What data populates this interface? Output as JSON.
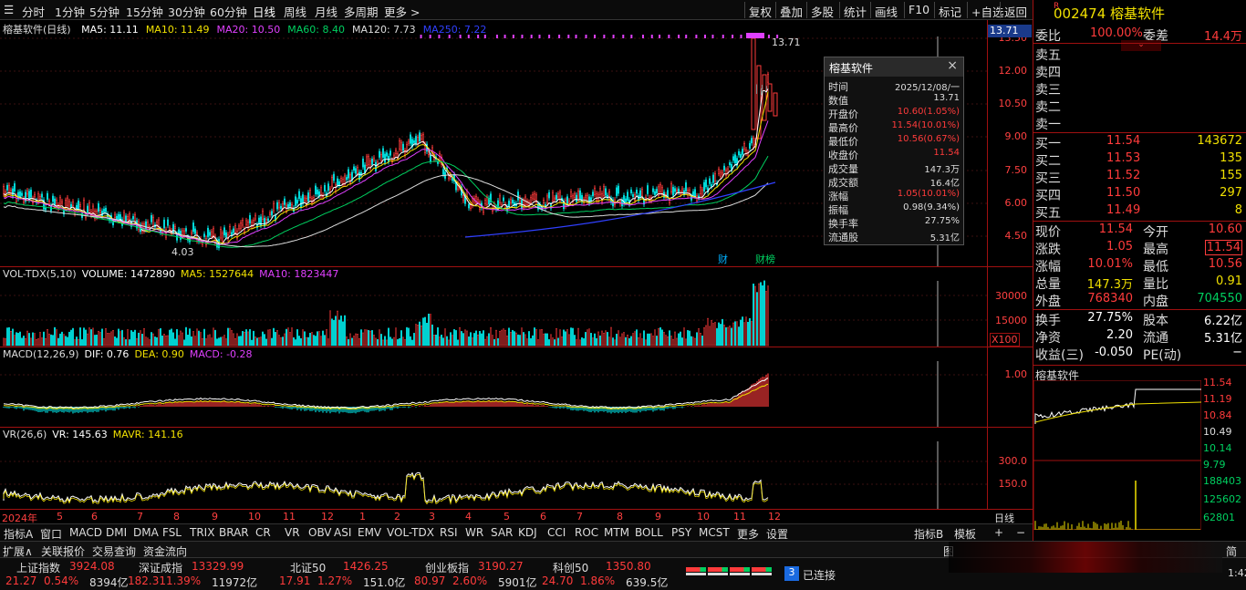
{
  "periods": [
    "分时",
    "1分钟",
    "5分钟",
    "15分钟",
    "30分钟",
    "60分钟",
    "日线",
    "周线",
    "月线",
    "多周期",
    "更多 >"
  ],
  "toolbar": [
    "复权",
    "叠加",
    "多股",
    "统计",
    "画线",
    "F10",
    "标记",
    "+自选",
    "返回"
  ],
  "main": {
    "title": "榕基软件(日线)",
    "ma": [
      {
        "label": "MA5: 11.11",
        "color": "#ffffff"
      },
      {
        "label": "MA10: 11.49",
        "color": "#f0e000"
      },
      {
        "label": "MA20: 10.50",
        "color": "#e040ff"
      },
      {
        "label": "MA60: 8.40",
        "color": "#00d060"
      },
      {
        "label": "MA120: 7.73",
        "color": "#dddddd"
      },
      {
        "label": "MA250: 7.22",
        "color": "#3040ff"
      }
    ],
    "price_ticks": [
      "13.50",
      "12.00",
      "10.50",
      "9.00",
      "7.50",
      "6.00",
      "4.50"
    ],
    "current_price_tag": "13.71",
    "high_mark": "13.71",
    "low_mark": "4.03",
    "markers": [
      "财",
      "财榜"
    ]
  },
  "volume": {
    "title": "VOL-TDX(5,10)",
    "values": [
      "VOLUME: 1472890",
      "MA5: 1527644",
      "MA10: 1823447"
    ],
    "ticks": [
      "30000",
      "15000"
    ],
    "unit": "X100"
  },
  "macd": {
    "title": "MACD(12,26,9)",
    "values": [
      "DIF: 0.76",
      "DEA: 0.90",
      "MACD: -0.28"
    ],
    "ticks": [
      "1.00"
    ]
  },
  "vr": {
    "title": "VR(26,6)",
    "values": [
      "VR: 145.63",
      "MAVR: 141.16"
    ],
    "ticks": [
      "300.0",
      "150.0"
    ]
  },
  "date_axis": [
    "2024年",
    "5",
    "6",
    "7",
    "8",
    "9",
    "10",
    "11",
    "12",
    "1",
    "2",
    "3",
    "4",
    "5",
    "6",
    "7",
    "8",
    "9",
    "10",
    "11",
    "12"
  ],
  "date_right": "日线",
  "indicator_tabs": [
    "指标A",
    "窗口",
    "MACD",
    "DMI",
    "DMA",
    "FSL",
    "TRIX",
    "BRAR",
    "CR",
    "VR",
    "OBV",
    "ASI",
    "EMV",
    "VOL-TDX",
    "RSI",
    "WR",
    "SAR",
    "KDJ",
    "CCI",
    "ROC",
    "MTM",
    "BOLL",
    "PSY",
    "MCST",
    "更多",
    "设置"
  ],
  "indicator_right": [
    "指标B",
    "模板",
    "+",
    "−"
  ],
  "bottom_tabs": [
    "扩展∧",
    "关联报价",
    "交易查询",
    "资金流向"
  ],
  "popup": {
    "title": "榕基软件",
    "rows": [
      {
        "k": "时间",
        "v": "2025/12/08/一",
        "c": "#dddddd"
      },
      {
        "k": "数值",
        "v": "13.71",
        "c": "#dddddd"
      },
      {
        "k": "开盘价",
        "v": "10.60(1.05%)",
        "c": "#ff3b3b"
      },
      {
        "k": "最高价",
        "v": "11.54(10.01%)",
        "c": "#ff3b3b"
      },
      {
        "k": "最低价",
        "v": "10.56(0.67%)",
        "c": "#ff3b3b"
      },
      {
        "k": "收盘价",
        "v": "11.54",
        "c": "#ff3b3b"
      },
      {
        "k": "成交量",
        "v": "147.3万",
        "c": "#dddddd"
      },
      {
        "k": "成交额",
        "v": "16.4亿",
        "c": "#dddddd"
      },
      {
        "k": "涨幅",
        "v": "1.05(10.01%)",
        "c": "#ff3b3b"
      },
      {
        "k": "振幅",
        "v": "0.98(9.34%)",
        "c": "#dddddd"
      },
      {
        "k": "换手率",
        "v": "27.75%",
        "c": "#dddddd"
      },
      {
        "k": "流通股",
        "v": "5.31亿",
        "c": "#dddddd"
      }
    ]
  },
  "quote": {
    "code": "002474",
    "name": "榕基软件",
    "ratio_label": "委比",
    "ratio_value": "100.00%",
    "diff_label": "委差",
    "diff_value": "14.4万",
    "sell": [
      "卖五",
      "卖四",
      "卖三",
      "卖二",
      "卖一"
    ],
    "buy": [
      {
        "label": "买一",
        "price": "11.54",
        "vol": "143672"
      },
      {
        "label": "买二",
        "price": "11.53",
        "vol": "135"
      },
      {
        "label": "买三",
        "price": "11.52",
        "vol": "155"
      },
      {
        "label": "买四",
        "price": "11.50",
        "vol": "297"
      },
      {
        "label": "买五",
        "price": "11.49",
        "vol": "8"
      }
    ],
    "stats": [
      {
        "l1": "现价",
        "v1": "11.54",
        "c1": "#ff3b3b",
        "l2": "今开",
        "v2": "10.60",
        "c2": "#ff3b3b"
      },
      {
        "l1": "涨跌",
        "v1": "1.05",
        "c1": "#ff3b3b",
        "l2": "最高",
        "v2": "11.54",
        "c2": "#ff3b3b"
      },
      {
        "l1": "涨幅",
        "v1": "10.01%",
        "c1": "#ff3b3b",
        "l2": "最低",
        "v2": "10.56",
        "c2": "#ff3b3b"
      },
      {
        "l1": "总量",
        "v1": "147.3万",
        "c1": "#f0e000",
        "l2": "量比",
        "v2": "0.91",
        "c2": "#f0e000"
      },
      {
        "l1": "外盘",
        "v1": "768340",
        "c1": "#ff3b3b",
        "l2": "内盘",
        "v2": "704550",
        "c2": "#00d060"
      }
    ],
    "stats2": [
      {
        "l1": "换手",
        "v1": "27.75%",
        "l2": "股本",
        "v2": "6.22亿"
      },
      {
        "l1": "净资",
        "v1": "2.20",
        "l2": "流通",
        "v2": "5.31亿"
      },
      {
        "l1": "收益(三)",
        "v1": "-0.050",
        "l2": "PE(动)",
        "v2": "−"
      }
    ],
    "mini_title": "榕基软件",
    "mini_ticks": [
      {
        "v": "11.54",
        "c": "#ff3b3b"
      },
      {
        "v": "11.19",
        "c": "#ff3b3b"
      },
      {
        "v": "10.84",
        "c": "#ff3b3b"
      },
      {
        "v": "10.49",
        "c": "#dddddd"
      },
      {
        "v": "10.14",
        "c": "#00d060"
      },
      {
        "v": "9.79",
        "c": "#00d060"
      }
    ],
    "mini_vol_ticks": [
      "188403",
      "125602",
      "62801"
    ]
  },
  "status": {
    "indices": [
      {
        "name": "上证指数",
        "price": "3924.08",
        "chg": "21.27",
        "pct": "0.54%",
        "amt": "8394亿"
      },
      {
        "name": "深证成指",
        "price": "13329.99",
        "chg": "182.31",
        "pct": "1.39%",
        "amt": "11972亿"
      },
      {
        "name": "北证50",
        "price": "1426.25",
        "chg": "17.91",
        "pct": "1.27%",
        "amt": "151.0亿"
      },
      {
        "name": "创业板指",
        "price": "3190.27",
        "chg": "80.97",
        "pct": "2.60%",
        "amt": "5901亿"
      },
      {
        "name": "科创50",
        "price": "1350.80",
        "chg": "24.70",
        "pct": "1.86%",
        "amt": "639.5亿"
      }
    ],
    "conn_count": "3",
    "conn_text": "已连接",
    "pic_label": "图",
    "right_label": "简",
    "time": "1:42"
  }
}
